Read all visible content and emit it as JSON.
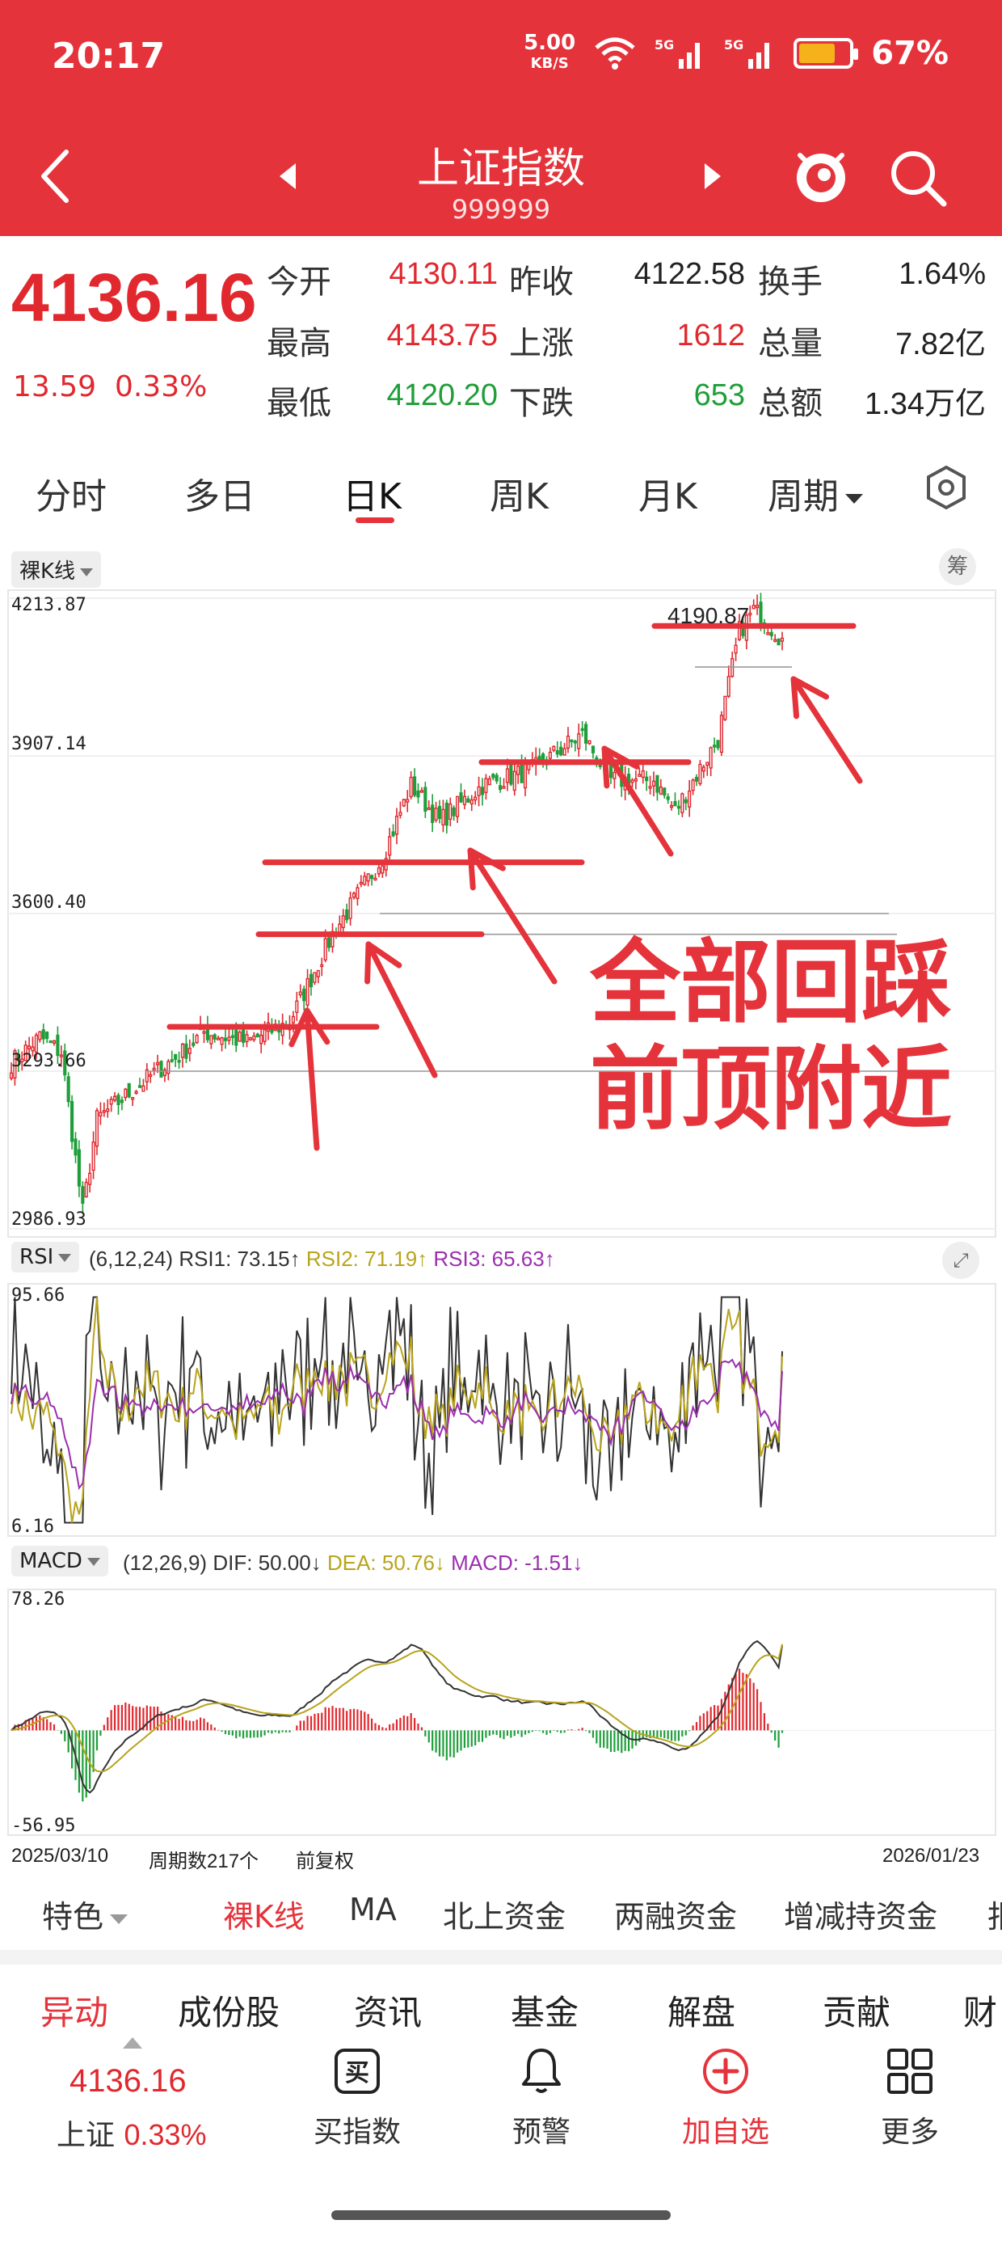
{
  "status_bar": {
    "time": "20:17",
    "net_speed": "5.00",
    "net_unit": "KB/S",
    "signal1": "5G",
    "signal2": "5G",
    "battery_text": "67%",
    "battery_level": 0.67
  },
  "header": {
    "title": "上证指数",
    "code": "999999",
    "icons": [
      "back-icon",
      "prev-icon",
      "next-icon",
      "mascot-icon",
      "search-icon"
    ]
  },
  "quote": {
    "price": "4136.16",
    "change": "13.59",
    "change_pct": "0.33%",
    "stats": [
      {
        "label": "今开",
        "value": "4130.11",
        "color": "#e0282e"
      },
      {
        "label": "昨收",
        "value": "4122.58",
        "color": "#222222"
      },
      {
        "label": "换手",
        "value": "1.64%",
        "color": "#222222"
      },
      {
        "label": "最高",
        "value": "4143.75",
        "color": "#e0282e"
      },
      {
        "label": "上涨",
        "value": "1612",
        "color": "#e0282e"
      },
      {
        "label": "总量",
        "value": "7.82亿",
        "color": "#222222"
      },
      {
        "label": "最低",
        "value": "4120.20",
        "color": "#1f9e3a"
      },
      {
        "label": "下跌",
        "value": "653",
        "color": "#1f9e3a"
      },
      {
        "label": "总额",
        "value": "1.34万亿",
        "color": "#222222"
      }
    ]
  },
  "period_tabs": [
    "分时",
    "多日",
    "日K",
    "周K",
    "月K",
    "周期"
  ],
  "period_active": 2,
  "chart": {
    "mode_label": "裸K线",
    "chip_label": "筹",
    "y_ticks": [
      "4213.87",
      "3907.14",
      "3600.40",
      "3293.66",
      "2986.93"
    ],
    "peak_label": "4190.87",
    "annotation_line1": "全部回踩",
    "annotation_line2": "前顶附近",
    "rsi": {
      "name": "RSI",
      "params": "(6,12,24)",
      "rsi1": "RSI1: 73.15↑",
      "rsi2": "RSI2: 71.19↑",
      "rsi3": "RSI3: 65.63↑",
      "y_max": "95.66",
      "y_min": "6.16"
    },
    "macd": {
      "name": "MACD",
      "params": "(12,26,9)",
      "dif": "DIF: 50.00↓",
      "dea": "DEA: 50.76↓",
      "macd": "MACD: -1.51↓",
      "y_max": "78.26",
      "y_min": "-56.95"
    },
    "date_start": "2025/03/10",
    "period_count": "周期数217个",
    "adjust": "前复权",
    "date_end": "2026/01/23",
    "colors": {
      "up": "#e0282e",
      "down": "#1f9e3a",
      "rsi1": "#333333",
      "rsi2": "#b8a41c",
      "rsi3": "#9b2fae"
    }
  },
  "chart_data": {
    "type": "candlestick",
    "x_range": [
      "2025/03/10",
      "2026/01/23"
    ],
    "ylim": [
      2986.93,
      4213.87
    ],
    "y_ticks": [
      4213.87,
      3907.14,
      3600.4,
      3293.66,
      2986.93
    ],
    "periods": 217,
    "approx_close_path": [
      {
        "i": 0,
        "v": 3310
      },
      {
        "i": 8,
        "v": 3360
      },
      {
        "i": 14,
        "v": 3330
      },
      {
        "i": 20,
        "v": 3020
      },
      {
        "i": 24,
        "v": 3200
      },
      {
        "i": 40,
        "v": 3290
      },
      {
        "i": 48,
        "v": 3330
      },
      {
        "i": 54,
        "v": 3370
      },
      {
        "i": 66,
        "v": 3350
      },
      {
        "i": 78,
        "v": 3390
      },
      {
        "i": 90,
        "v": 3560
      },
      {
        "i": 104,
        "v": 3710
      },
      {
        "i": 112,
        "v": 3850
      },
      {
        "i": 120,
        "v": 3780
      },
      {
        "i": 132,
        "v": 3850
      },
      {
        "i": 146,
        "v": 3880
      },
      {
        "i": 160,
        "v": 3950
      },
      {
        "i": 168,
        "v": 3860
      },
      {
        "i": 180,
        "v": 3860
      },
      {
        "i": 186,
        "v": 3800
      },
      {
        "i": 198,
        "v": 3940
      },
      {
        "i": 204,
        "v": 4150
      },
      {
        "i": 208,
        "v": 4190.87
      },
      {
        "i": 216,
        "v": 4136.16
      }
    ],
    "peak": 4190.87,
    "rsi_range": [
      6.16,
      95.66
    ],
    "rsi_latest": {
      "RSI1": 73.15,
      "RSI2": 71.19,
      "RSI3": 65.63
    },
    "macd_range": [
      -56.95,
      78.26
    ],
    "macd_latest": {
      "DIF": 50.0,
      "DEA": 50.76,
      "MACD": -1.51
    }
  },
  "indicator_tabs": [
    "特色",
    "裸K线",
    "MA",
    "北上资金",
    "两融资金",
    "增减持资金",
    "报"
  ],
  "indicator_active": 1,
  "bottom_tabs": [
    "异动",
    "成份股",
    "资讯",
    "基金",
    "解盘",
    "贡献",
    "财"
  ],
  "bottom_active": 0,
  "bottom_quote": {
    "price": "4136.16",
    "name": "上证",
    "pct": "0.33%"
  },
  "actions": [
    {
      "label": "买指数",
      "icon": "buy-icon",
      "glyph": "买"
    },
    {
      "label": "预警",
      "icon": "bell-icon"
    },
    {
      "label": "加自选",
      "icon": "plus-circle-icon"
    },
    {
      "label": "更多",
      "icon": "grid-icon"
    }
  ]
}
